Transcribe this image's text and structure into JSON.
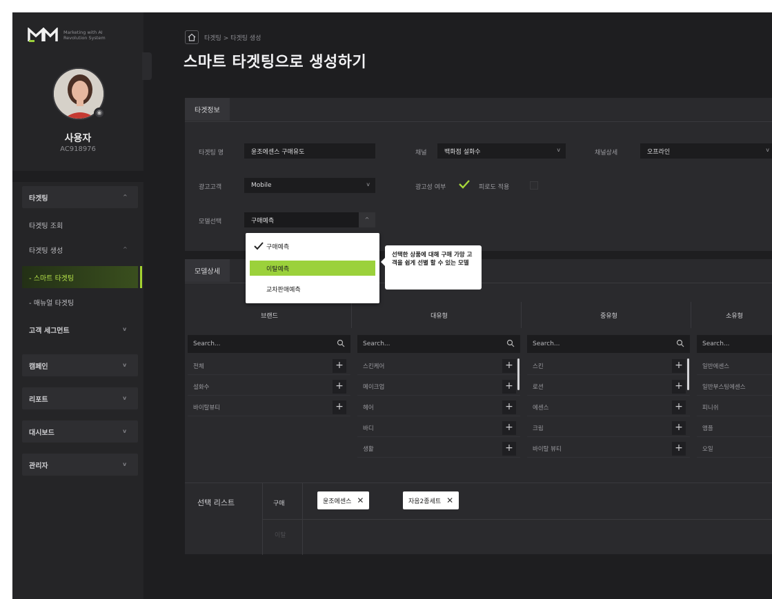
{
  "brand": {
    "tagline": "Marketing with AI Revolution System"
  },
  "user": {
    "name": "사용자",
    "id": "AC918976"
  },
  "sidebar": {
    "items": [
      {
        "label": "타겟팅",
        "chevron": "^"
      },
      {
        "label": "타겟팅 조회"
      },
      {
        "label": "타겟팅 생성",
        "chevron": "^"
      },
      {
        "label": "- 스마트 타겟팅"
      },
      {
        "label": "- 매뉴얼 타겟팅"
      },
      {
        "label": "고객 세그먼트",
        "chevron": "v"
      },
      {
        "label": "캠페인",
        "chevron": "v"
      },
      {
        "label": "리포트",
        "chevron": "v"
      },
      {
        "label": "대시보드",
        "chevron": "v"
      },
      {
        "label": "관리자",
        "chevron": "v"
      }
    ]
  },
  "header": {
    "breadcrumb": "타겟팅 > 타겟팅 생성",
    "title": "스마트 타겟팅으로 생성하기"
  },
  "target_info": {
    "tab": "타겟정보",
    "name_label": "타겟팅 명",
    "name_value": "윤조에센스 구매유도",
    "channel_label": "채널",
    "channel_value": "백화점 설화수",
    "channel_detail_label": "채널상세",
    "channel_detail_value": "오프라인",
    "ad_label": "광고고객",
    "ad_value": "Mobile",
    "ad_consent_label": "광고성 여부",
    "fatigue_label": "피로도 적용",
    "model_label": "모델선택",
    "model_value": "구매예측"
  },
  "model_dropdown": {
    "options": [
      "구매예측",
      "이탈예측",
      "교차판매예측"
    ],
    "tooltip": "선택한 상품에 대해 구매 가망 고객을 쉽게 선별 할 수 있는 모델"
  },
  "model_detail": {
    "tab": "모델상세",
    "columns": [
      {
        "header": "브랜드",
        "search": "Search...",
        "rows": [
          "전체",
          "설화수",
          "바이탈뷰티"
        ]
      },
      {
        "header": "대유형",
        "search": "Search...",
        "rows": [
          "스킨케어",
          "메이크업",
          "헤어",
          "바디",
          "생활"
        ]
      },
      {
        "header": "중유형",
        "search": "Search...",
        "rows": [
          "스킨",
          "로션",
          "에센스",
          "크림",
          "바이탈 뷰티"
        ]
      },
      {
        "header": "소유형",
        "search": "Search...",
        "rows": [
          "일반에센스",
          "일반부스팅에센스",
          "피니쉬",
          "앰플",
          "오일"
        ]
      }
    ]
  },
  "selection": {
    "title": "선택 리스트",
    "row1_label": "구매",
    "row2_label": "이탈",
    "chips": [
      "윤조에센스",
      "자음2종세트"
    ]
  },
  "colors": {
    "accent": "#9bd13b",
    "background": "#1e1e20",
    "panel": "#2a2a2d"
  }
}
